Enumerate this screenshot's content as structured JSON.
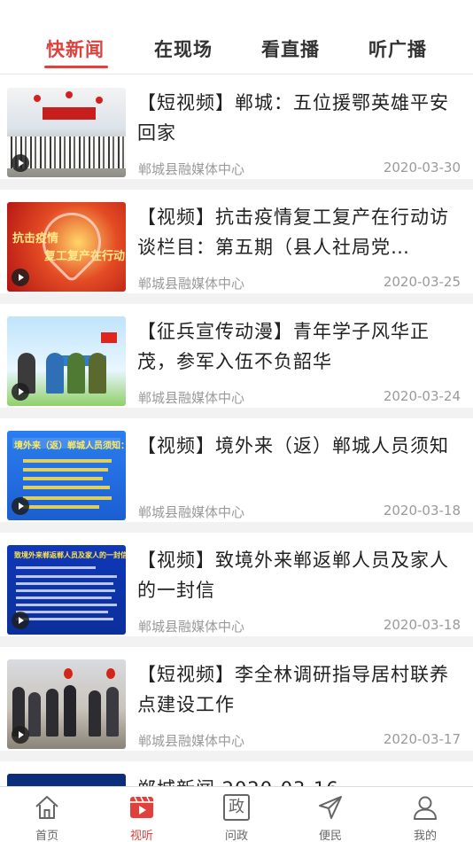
{
  "tabs": [
    {
      "label": "快新闻",
      "active": true
    },
    {
      "label": "在现场",
      "active": false
    },
    {
      "label": "看直播",
      "active": false
    },
    {
      "label": "听广播",
      "active": false
    }
  ],
  "accent_color": "#e0413c",
  "articles": [
    {
      "title": "【短视频】郸城：五位援鄂英雄平安回家",
      "source": "郸城县融媒体中心",
      "date": "2020-03-30",
      "thumb_icon": "play-icon"
    },
    {
      "title": "【视频】抗击疫情复工复产在行动访谈栏目：第五期（县人社局党…",
      "source": "郸城县融媒体中心",
      "date": "2020-03-25",
      "thumb_icon": "play-icon",
      "thumb_text": [
        "抗击疫情",
        "复工复产在行动"
      ]
    },
    {
      "title": "【征兵宣传动漫】青年学子风华正茂，参军入伍不负韶华",
      "source": "郸城县融媒体中心",
      "date": "2020-03-24",
      "thumb_icon": "play-icon"
    },
    {
      "title": "【视频】境外来（返）郸城人员须知",
      "source": "郸城县融媒体中心",
      "date": "2020-03-18",
      "thumb_icon": "play-icon",
      "thumb_text": [
        "境外来（返）郸城人员须知："
      ]
    },
    {
      "title": "【视频】致境外来郸返郸人员及家人的一封信",
      "source": "郸城县融媒体中心",
      "date": "2020-03-18",
      "thumb_icon": "play-icon",
      "thumb_text": [
        "致境外来郸返郸人员及家人的一封信"
      ]
    },
    {
      "title": "【短视频】李全林调研指导居村联养点建设工作",
      "source": "郸城县融媒体中心",
      "date": "2020-03-17",
      "thumb_icon": "play-icon"
    },
    {
      "title": "郸城新闻 2020-03-16"
    }
  ],
  "bottom_nav": [
    {
      "label": "首页",
      "icon": "home-icon",
      "active": false
    },
    {
      "label": "视听",
      "icon": "video-icon",
      "active": true
    },
    {
      "label": "问政",
      "icon": "zheng-icon",
      "glyph": "政",
      "active": false
    },
    {
      "label": "便民",
      "icon": "send-icon",
      "active": false
    },
    {
      "label": "我的",
      "icon": "user-icon",
      "active": false
    }
  ]
}
